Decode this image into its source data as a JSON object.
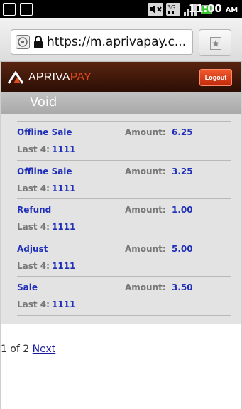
{
  "status_bar": {
    "time": "11:00",
    "ampm": "AM",
    "icons": [
      "usb-icon",
      "android-icon",
      "mute-icon",
      "3g-icon",
      "signal-icon",
      "battery-icon"
    ]
  },
  "browser": {
    "url": "https://m.aprivapay.c..."
  },
  "header": {
    "brand_part1": "APRIVA",
    "brand_part2": "PAY",
    "logout_label": "Logout"
  },
  "page": {
    "title": "Void"
  },
  "labels": {
    "amount": "Amount:",
    "last4": "Last 4:"
  },
  "transactions": [
    {
      "type": "Offline Sale",
      "amount": "6.25",
      "last4": "1111"
    },
    {
      "type": "Offline Sale",
      "amount": "3.25",
      "last4": "1111"
    },
    {
      "type": "Refund",
      "amount": "1.00",
      "last4": "1111"
    },
    {
      "type": "Adjust",
      "amount": "5.00",
      "last4": "1111"
    },
    {
      "type": "Sale",
      "amount": "3.50",
      "last4": "1111"
    }
  ],
  "pagination": {
    "text": "1 of 2",
    "next_label": "Next"
  },
  "colors": {
    "link_blue": "#1f2fb8",
    "header_brown": "#3a150a",
    "brand_orange": "#e34a1c",
    "logout_red": "#d83a16"
  }
}
